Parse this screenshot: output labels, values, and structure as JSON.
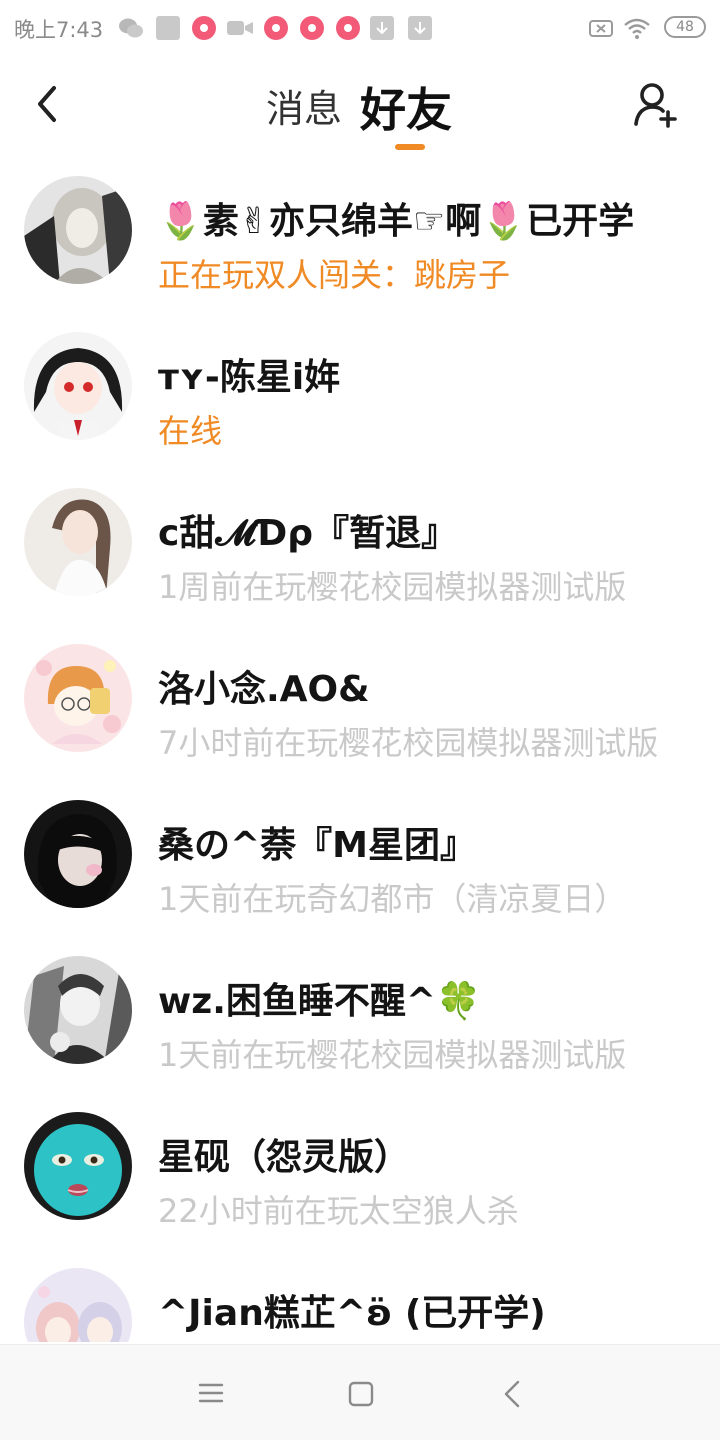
{
  "status_bar": {
    "time": "晚上7:43",
    "battery": "48"
  },
  "header": {
    "tab_messages": "消息",
    "tab_friends": "好友",
    "active_tab": "好友",
    "accent_color": "#f08a24"
  },
  "friends": [
    {
      "name": "🌷素✌亦只绵羊☞啊🌷已开学",
      "status": "正在玩双人闯关：跳房子",
      "status_active": true
    },
    {
      "name": "ᴛʏ-陈星i姩",
      "status": "在线",
      "status_active": true
    },
    {
      "name": "c甜𝓜Ɗρ『暂退』",
      "status": "1周前在玩樱花校园模拟器测试版",
      "status_active": false
    },
    {
      "name": "洛小念.AO&",
      "status": "7小时前在玩樱花校园模拟器测试版",
      "status_active": false
    },
    {
      "name": "桑の^萘『M星团』",
      "status": "1天前在玩奇幻都市（清凉夏日）",
      "status_active": false
    },
    {
      "name": "wz.困鱼睡不醒^🍀",
      "status": "1天前在玩樱花校园模拟器测试版",
      "status_active": false
    },
    {
      "name": "星砚（怨灵版）",
      "status": "22小时前在玩太空狼人杀",
      "status_active": false
    },
    {
      "name": "^Jian糕芷^ʚ̈ (已开学)",
      "status": "",
      "status_active": false
    }
  ],
  "icons": {
    "back": "chevron-left-icon",
    "add_friend": "add-user-icon",
    "nav_menu": "menu-icon",
    "nav_home": "square-icon",
    "nav_back": "back-icon"
  }
}
